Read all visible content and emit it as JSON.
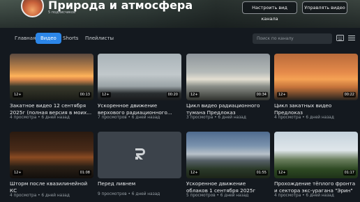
{
  "channel": {
    "title": "Природа и атмосфера",
    "subscribers": "5 подписчиков",
    "customize_label": "Настроить вид канала",
    "manage_label": "Управлять видео"
  },
  "tabs": [
    {
      "label": "Главная",
      "active": false
    },
    {
      "label": "Видео",
      "active": true
    },
    {
      "label": "Shorts",
      "active": false
    },
    {
      "label": "Плейлисты",
      "active": false
    }
  ],
  "search": {
    "placeholder": "Поиск по каналу",
    "icon": "search-icon"
  },
  "toolbar_icons": [
    "keyboard-icon",
    "list-view-icon"
  ],
  "accent_color": "#2c86e8",
  "videos": [
    {
      "title": "Закатное видео 12 сентября 2025г (полная версия в моих...",
      "views": "4 просмотра",
      "age": "6 дней назад",
      "rating": "12+",
      "duration": "00:13"
    },
    {
      "title": "Ускоренное движение верхового радиационного...",
      "views": "7 просмотров",
      "age": "6 дней назад",
      "rating": "12+",
      "duration": "00:20"
    },
    {
      "title": "Цикл видео радиационного тумана Предлоказ",
      "views": "3 просмотра",
      "age": "6 дней назад",
      "rating": "12+",
      "duration": "00:34"
    },
    {
      "title": "Цикл закатных видео Предлоказ",
      "views": "4 просмотра",
      "age": "6 дней назад",
      "rating": "12+",
      "duration": "00:22"
    },
    {
      "title": "Шторм после квазилинейной КС",
      "views": "4 просмотра",
      "age": "6 дней назад",
      "rating": "12+",
      "duration": "01:08"
    },
    {
      "title": "Перед ливнем",
      "views": "9 просмотров",
      "age": "6 дней назад",
      "rating": "",
      "duration": ""
    },
    {
      "title": "Ускоренное движение облаков 1 сентября 2025г",
      "views": "5 просмотров",
      "age": "6 дней назад",
      "rating": "12+",
      "duration": "01:55"
    },
    {
      "title": "Прохождение тёплого фронта и сектора экс-урагана \"Эрин\"",
      "views": "4 просмотра",
      "age": "6 дней назад",
      "rating": "12+",
      "duration": "01:17"
    }
  ]
}
